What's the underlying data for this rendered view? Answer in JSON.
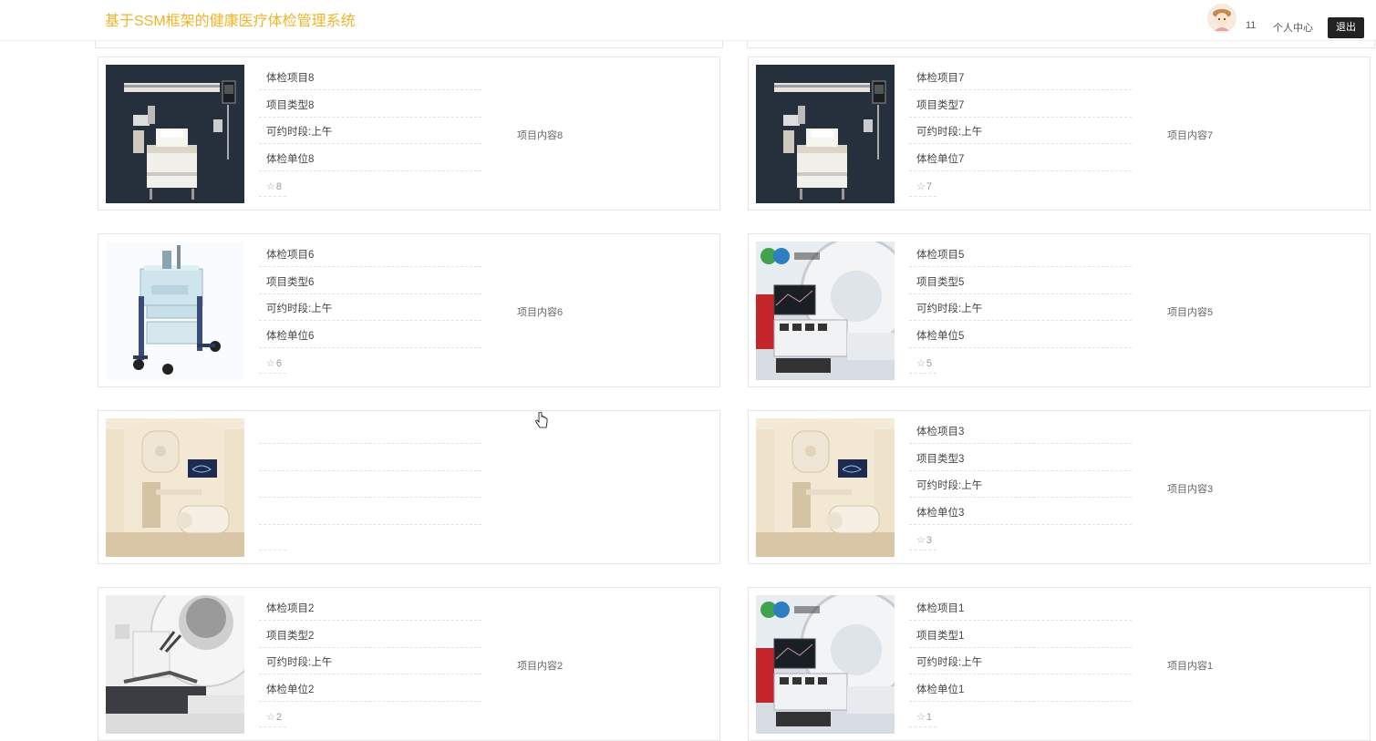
{
  "header": {
    "title": "基于SSM框架的健康医疗体检管理系统",
    "username": "11",
    "profile_label": "个人中心",
    "logout_label": "退出"
  },
  "colors": {
    "title": "#f0b428",
    "logout_bg": "#222222",
    "border": "#e6e6e6"
  },
  "cards": [
    {
      "name": "体检项目8",
      "type": "项目类型8",
      "slot": "可约时段:上午",
      "unit": "体检单位8",
      "fav": "8",
      "content": "项目内容8",
      "image": "hospital-bed"
    },
    {
      "name": "体检项目7",
      "type": "项目类型7",
      "slot": "可约时段:上午",
      "unit": "体检单位7",
      "fav": "7",
      "content": "项目内容7",
      "image": "hospital-bed"
    },
    {
      "name": "体检项目6",
      "type": "项目类型6",
      "slot": "可约时段:上午",
      "unit": "体检单位6",
      "fav": "6",
      "content": "项目内容6",
      "image": "medical-cart"
    },
    {
      "name": "体检项目5",
      "type": "项目类型5",
      "slot": "可约时段:上午",
      "unit": "体检单位5",
      "fav": "5",
      "content": "项目内容5",
      "image": "ct-scanner"
    },
    {
      "name": "",
      "type": "",
      "slot": "",
      "unit": "",
      "fav": "",
      "content": "",
      "image": "radiotherapy-room"
    },
    {
      "name": "体检项目3",
      "type": "项目类型3",
      "slot": "可约时段:上午",
      "unit": "体检单位3",
      "fav": "3",
      "content": "项目内容3",
      "image": "radiotherapy-room"
    },
    {
      "name": "体检项目2",
      "type": "项目类型2",
      "slot": "可约时段:上午",
      "unit": "体检单位2",
      "fav": "2",
      "content": "项目内容2",
      "image": "mri-machine"
    },
    {
      "name": "体检项目1",
      "type": "项目类型1",
      "slot": "可约时段:上午",
      "unit": "体检单位1",
      "fav": "1",
      "content": "项目内容1",
      "image": "ct-scanner"
    }
  ]
}
